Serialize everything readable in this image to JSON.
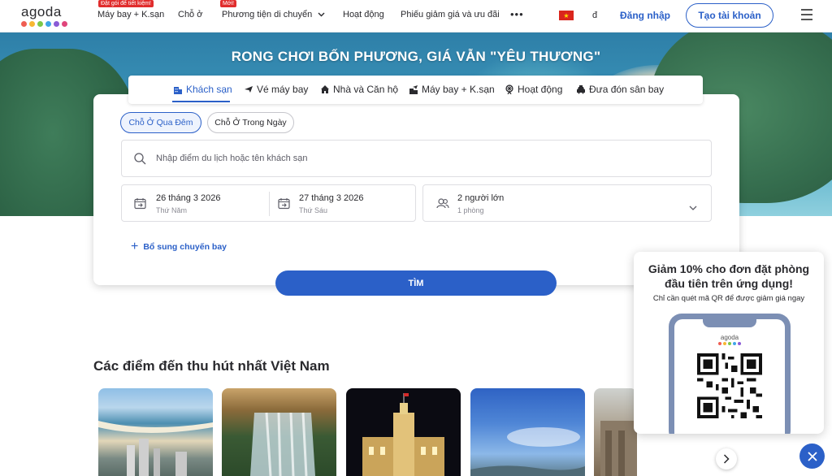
{
  "header": {
    "logo_text": "agoda",
    "logo_dot_colors": [
      "#ef5d52",
      "#f7b731",
      "#7cc84a",
      "#3ea6e8",
      "#8a5bd6",
      "#e0457b"
    ],
    "nav": [
      {
        "label": "Máy bay + K.sạn",
        "badge": "Đặt gói để tiết kiệm!"
      },
      {
        "label": "Chỗ ở",
        "badge": ""
      },
      {
        "label": "Phương tiện di chuyển",
        "badge": "Mới!"
      },
      {
        "label": "Hoạt động",
        "badge": ""
      },
      {
        "label": "Phiếu giảm giá và ưu đãi",
        "badge": ""
      }
    ],
    "more_icon": "•••",
    "currency": "đ",
    "login_label": "Đăng nhập",
    "signup_label": "Tạo tài khoản",
    "accent_color": "#2b60c8"
  },
  "hero": {
    "title": "RONG CHƠI BỐN PHƯƠNG, GIÁ VẪN \"YÊU THƯƠNG\""
  },
  "tabs": [
    {
      "label": "Khách sạn",
      "icon": "hotel-icon",
      "active": true
    },
    {
      "label": "Vé máy bay",
      "icon": "plane-icon",
      "active": false
    },
    {
      "label": "Nhà và Căn hộ",
      "icon": "house-icon",
      "active": false
    },
    {
      "label": "Máy bay + K.sạn",
      "icon": "plane-hotel-icon",
      "active": false
    },
    {
      "label": "Hoạt động",
      "icon": "ferris-wheel-icon",
      "active": false
    },
    {
      "label": "Đưa đón sân bay",
      "icon": "taxi-icon",
      "active": false
    }
  ],
  "search": {
    "stay_types": [
      "Chỗ Ở Qua Đêm",
      "Chỗ Ở Trong Ngày"
    ],
    "destination_placeholder": "Nhập điểm du lịch hoặc tên khách sạn",
    "checkin": {
      "date": "26 tháng 3 2026",
      "day": "Thứ Năm"
    },
    "checkout": {
      "date": "27 tháng 3 2026",
      "day": "Thứ Sáu"
    },
    "guests": {
      "main": "2 người lớn",
      "sub": "1 phòng"
    },
    "add_flight_label": "Bổ sung chuyến bay",
    "search_label": "TÌM"
  },
  "destinations": {
    "title": "Các điểm đến thu hút nhất Việt Nam"
  },
  "promo": {
    "title_line1": "Giảm 10% cho đơn đặt phòng",
    "title_line2": "đầu tiên trên ứng dụng!",
    "subtitle": "Chỉ cần quét mã QR để được giảm giá ngay",
    "mini_logo": "agoda"
  }
}
